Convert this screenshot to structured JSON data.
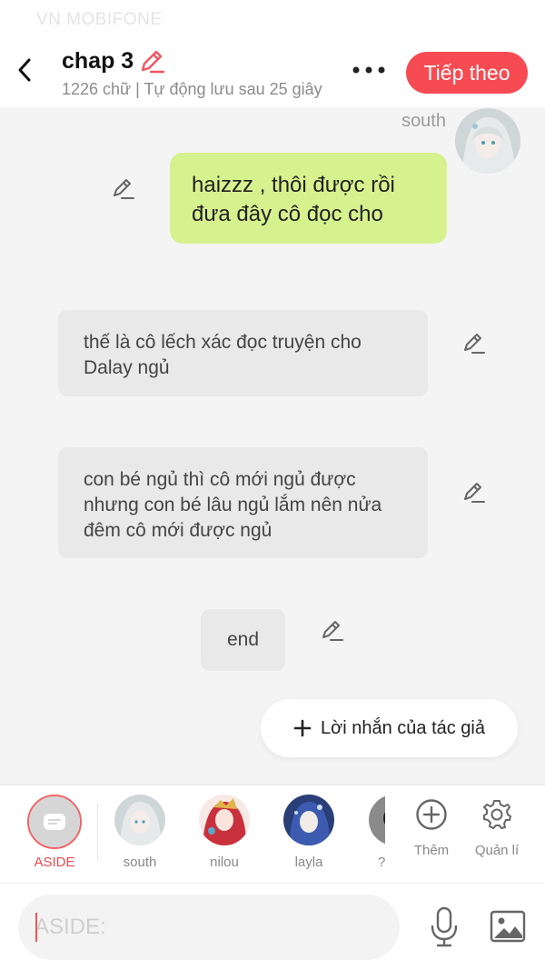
{
  "status": {
    "carrier": "VN MOBIFONE"
  },
  "header": {
    "title": "chap 3",
    "subtitle": "1226 chữ | Tự động lưu sau 25 giây",
    "next_label": "Tiếp theo"
  },
  "messages": {
    "m1": {
      "sender": "south",
      "text": "haizzz , thôi được rồi đưa đây cô đọc cho"
    },
    "n1": "thế là cô lếch xác đọc truyện cho Dalay ngủ",
    "n2": "con bé ngủ thì cô mới ngủ được nhưng con bé lâu ngủ lắm nên nửa đêm cô mới được ngủ",
    "n3": "end"
  },
  "author_note": {
    "label": "Lời nhắn của tác giả"
  },
  "characters": [
    {
      "name": "ASIDE"
    },
    {
      "name": "south"
    },
    {
      "name": "nilou"
    },
    {
      "name": "layla"
    },
    {
      "name": "?"
    }
  ],
  "tools": {
    "add_label": "Thêm",
    "manage_label": "Quản lí"
  },
  "input": {
    "placeholder": "ASIDE:"
  },
  "colors": {
    "accent": "#f64b52",
    "bubble": "#d6f28e",
    "narration": "#e9e9e9"
  }
}
